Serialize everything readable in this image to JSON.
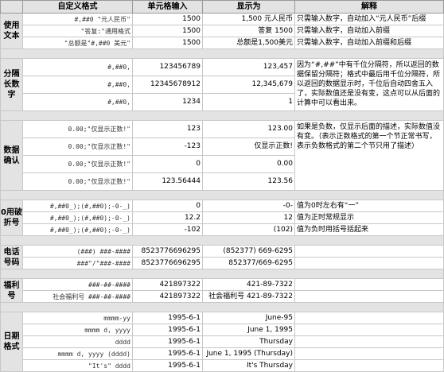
{
  "headers": [
    "",
    "自定义格式",
    "单元格输入",
    "显示为",
    "解释"
  ],
  "sections": {
    "text": {
      "category": "使用文本",
      "rows": [
        {
          "fmt": "#,##0 \"元人民币\"",
          "input": "1500",
          "display": "1,500 元人民币",
          "explanation": "只需输入数字，自动加入“元人民币”后缀"
        },
        {
          "fmt": "\"答复:\"通用格式",
          "input": "1500",
          "display": "答复 1500",
          "explanation": "只需输入数字，自动加入前缀"
        },
        {
          "fmt": "\"总额是\"#,##0 美元\"",
          "input": "1500",
          "display": "总额是1,500美元",
          "explanation": "只需输入数字，自动加入前缀和后缀"
        }
      ]
    },
    "separator": {
      "category": "分隔长数字",
      "explanation": "因为“#,##”中有千位分隔符，所以返回的数据保留分隔符；格式中最后用千位分隔符，所以返回的数据显示时，千位后自动四舍五入了，实际数值还是没有变，这点可以从后面的计算中可以看出来。",
      "rows": [
        {
          "fmt": "#,##0,",
          "input": "123456789",
          "display": "123,457"
        },
        {
          "fmt": "#,##0,",
          "input": "12345678912",
          "display": "12,345,679"
        },
        {
          "fmt": "#,##0,",
          "input": "1234",
          "display": "1"
        }
      ]
    },
    "confirm": {
      "category": "数据确认",
      "explanation": "如果是负数，仅显示后面的描述，实际数值没有变。（表示正数格式的第一个节正常书写，表示负数格式的第二个节只用了描述）",
      "rows": [
        {
          "fmt": "0.00;\"仅显示正数!\"",
          "input": "123",
          "display": "123.00"
        },
        {
          "fmt": "0.00;\"仅显示正数!\"",
          "input": "-123",
          "display": "仅显示正数!"
        },
        {
          "fmt": "0.00;\"仅显示正数!\"",
          "input": "0",
          "display": "0.00"
        },
        {
          "fmt": "0.00;\"仅显示正数!\"",
          "input": "123.56444",
          "display": "123.56"
        }
      ]
    },
    "zero": {
      "category": "0用破折号",
      "rows": [
        {
          "fmt": "#,##0_);(#,##0);-0-_)",
          "input": "0",
          "display": "-0-",
          "explanation": "值为0时左右有“一”"
        },
        {
          "fmt": "#,##0_);(#,##0);-0-_)",
          "input": "12.2",
          "display": "12",
          "explanation": "值为正时常规显示"
        },
        {
          "fmt": "#,##0_);(#,##0);-0-_)",
          "input": "-102",
          "display": "(102)",
          "explanation": "值为负时用括号括起来"
        }
      ]
    },
    "phone": {
      "category": "电话号码",
      "rows": [
        {
          "fmt": "(###) ###-####",
          "input": "8523776696295",
          "display": "(852377) 669-6295",
          "explanation": ""
        },
        {
          "fmt": "###\"/\"###-####",
          "input": "8523776696295",
          "display": "852377/669-6295",
          "explanation": ""
        }
      ]
    },
    "welfare": {
      "category": "福利号",
      "rows": [
        {
          "fmt": "###-##-####",
          "input": "421897322",
          "display": "421-89-7322",
          "explanation": ""
        },
        {
          "fmt": "社会福利号 ###-##-####",
          "input": "421897322",
          "display": "社会福利号 421-89-7322",
          "explanation": ""
        }
      ]
    },
    "date": {
      "category": "日期格式",
      "rows": [
        {
          "fmt": "mmmm-yy",
          "input": "1995-6-1",
          "display": "June-95",
          "explanation": ""
        },
        {
          "fmt": "mmmm d, yyyy",
          "input": "1995-6-1",
          "display": "June 1, 1995",
          "explanation": ""
        },
        {
          "fmt": "dddd",
          "input": "1995-6-1",
          "display": "Thursday",
          "explanation": ""
        },
        {
          "fmt": "mmmm d, yyyy (dddd)",
          "input": "1995-6-1",
          "display": "June 1, 1995 (Thursday)",
          "explanation": ""
        },
        {
          "fmt": "\"It's\" dddd",
          "input": "1995-6-1",
          "display": "It's Thursday",
          "explanation": ""
        }
      ]
    }
  }
}
